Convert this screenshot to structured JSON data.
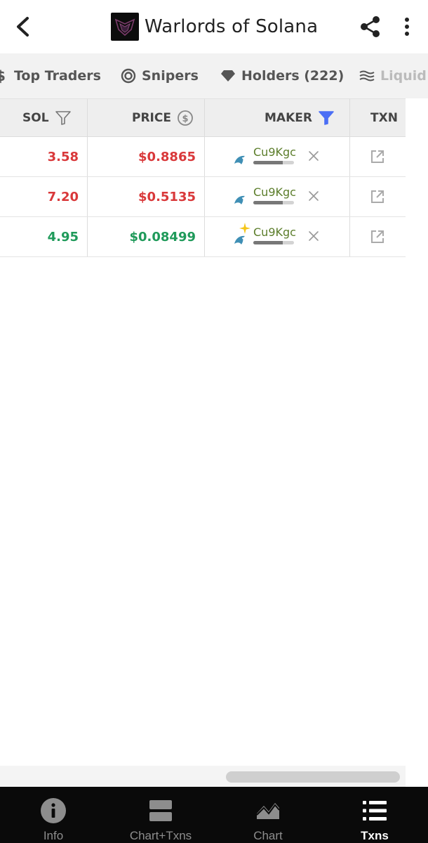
{
  "header": {
    "title": "Warlords of Solana",
    "back_icon": "chevron-left-icon",
    "share_icon": "share-icon",
    "more_icon": "more-vertical-icon"
  },
  "tabs": [
    {
      "label": "Top Traders",
      "icon": "dollar-icon"
    },
    {
      "label": "Snipers",
      "icon": "target-icon"
    },
    {
      "label": "Holders (222)",
      "icon": "diamond-icon"
    },
    {
      "label": "Liquid",
      "icon": "waves-icon"
    }
  ],
  "table": {
    "headers": {
      "sol": "SOL",
      "price": "PRICE",
      "maker": "MAKER",
      "txn": "TXN"
    },
    "rows": [
      {
        "sol": "3.58",
        "price": "$0.8865",
        "maker": "Cu9Kgc",
        "type": "sell",
        "maker_fill": 0.72,
        "new_badge": false
      },
      {
        "sol": "7.20",
        "price": "$0.5135",
        "maker": "Cu9Kgc",
        "type": "sell",
        "maker_fill": 0.72,
        "new_badge": false
      },
      {
        "sol": "4.95",
        "price": "$0.08499",
        "maker": "Cu9Kgc",
        "type": "buy",
        "maker_fill": 0.72,
        "new_badge": true
      }
    ]
  },
  "colors": {
    "sell": "#d9383a",
    "buy": "#1f9a5a",
    "filter_active": "#4b6ef5"
  },
  "bottom_nav": [
    {
      "label": "Info",
      "icon": "info-icon",
      "active": false
    },
    {
      "label": "Chart+Txns",
      "icon": "split-view-icon",
      "active": false
    },
    {
      "label": "Chart",
      "icon": "chart-icon",
      "active": false
    },
    {
      "label": "Txns",
      "icon": "list-icon",
      "active": true
    }
  ]
}
